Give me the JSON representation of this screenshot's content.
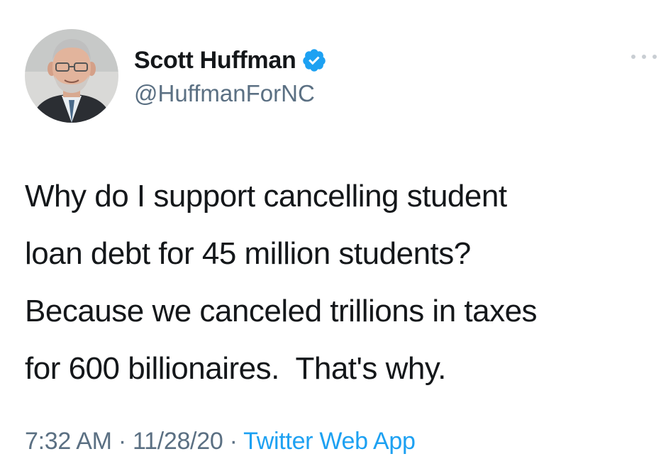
{
  "author": {
    "display_name": "Scott Huffman",
    "handle": "@HuffmanForNC",
    "verified": true,
    "avatar_icon": "profile-photo",
    "verified_icon": "verified-badge-icon"
  },
  "tweet": {
    "text_lines": [
      "Why do I support cancelling student",
      "loan debt for 45 million students?",
      "Because we canceled trillions in taxes",
      "for 600 billionaires.  That's why."
    ],
    "time": "7:32 AM",
    "date": "11/28/20",
    "separator": "·",
    "source": "Twitter Web App"
  },
  "menu": {
    "icon": "more-icon"
  },
  "colors": {
    "text": "#14171a",
    "secondary": "#5b7083",
    "accent": "#1da1f2"
  }
}
